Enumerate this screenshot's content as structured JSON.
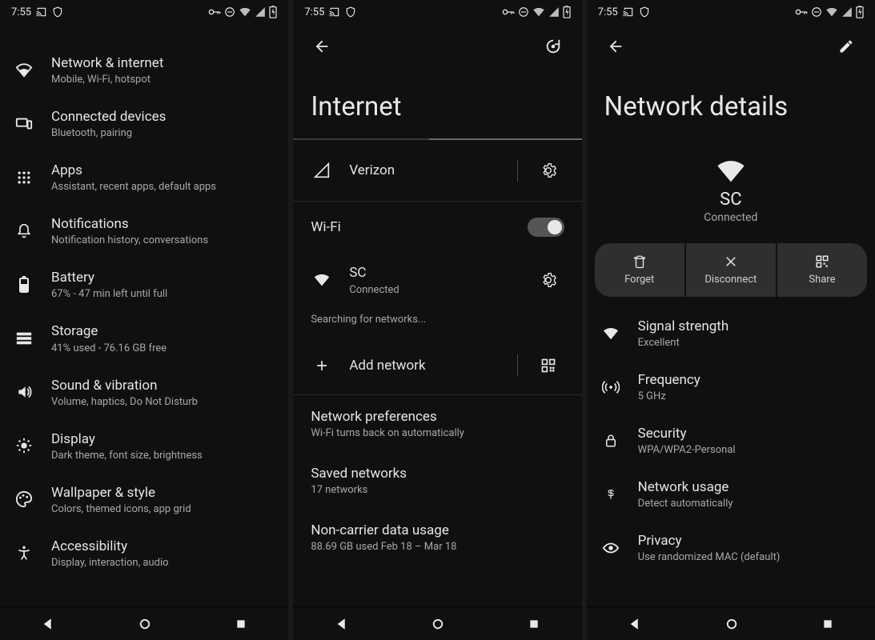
{
  "status": {
    "time": "7:55"
  },
  "screen1": {
    "items": [
      {
        "title": "Network & internet",
        "sub": "Mobile, Wi-Fi, hotspot",
        "icon": "wifi-icon"
      },
      {
        "title": "Connected devices",
        "sub": "Bluetooth, pairing",
        "icon": "devices-icon"
      },
      {
        "title": "Apps",
        "sub": "Assistant, recent apps, default apps",
        "icon": "apps-icon"
      },
      {
        "title": "Notifications",
        "sub": "Notification history, conversations",
        "icon": "bell-icon"
      },
      {
        "title": "Battery",
        "sub": "67% - 47 min left until full",
        "icon": "battery-icon"
      },
      {
        "title": "Storage",
        "sub": "41% used - 76.16 GB free",
        "icon": "storage-icon"
      },
      {
        "title": "Sound & vibration",
        "sub": "Volume, haptics, Do Not Disturb",
        "icon": "volume-icon"
      },
      {
        "title": "Display",
        "sub": "Dark theme, font size, brightness",
        "icon": "brightness-icon"
      },
      {
        "title": "Wallpaper & style",
        "sub": "Colors, themed icons, app grid",
        "icon": "palette-icon"
      },
      {
        "title": "Accessibility",
        "sub": "Display, interaction, audio",
        "icon": "accessibility-icon"
      }
    ]
  },
  "screen2": {
    "title": "Internet",
    "carrier": "Verizon",
    "wifi_label": "Wi-Fi",
    "wifi_on": true,
    "connected": {
      "ssid": "SC",
      "status": "Connected"
    },
    "searching": "Searching for networks...",
    "add_label": "Add network",
    "prefs": {
      "title": "Network preferences",
      "sub": "Wi-Fi turns back on automatically"
    },
    "saved": {
      "title": "Saved networks",
      "sub": "17 networks"
    },
    "usage": {
      "title": "Non-carrier data usage",
      "sub": "88.69 GB used Feb 18 – Mar 18"
    }
  },
  "screen3": {
    "title": "Network details",
    "ssid": "SC",
    "status": "Connected",
    "actions": {
      "forget": "Forget",
      "disconnect": "Disconnect",
      "share": "Share"
    },
    "details": [
      {
        "title": "Signal strength",
        "sub": "Excellent",
        "icon": "wifi-icon"
      },
      {
        "title": "Frequency",
        "sub": "5 GHz",
        "icon": "broadcast-icon"
      },
      {
        "title": "Security",
        "sub": "WPA/WPA2-Personal",
        "icon": "lock-icon"
      },
      {
        "title": "Network usage",
        "sub": "Detect automatically",
        "icon": "dollar-icon"
      },
      {
        "title": "Privacy",
        "sub": "Use randomized MAC (default)",
        "icon": "eye-icon"
      }
    ]
  }
}
